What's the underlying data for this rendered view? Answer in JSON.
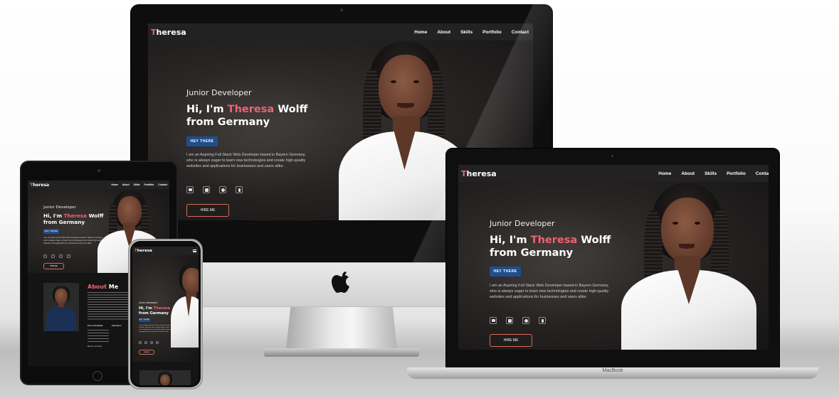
{
  "site": {
    "logo_initial": "T",
    "logo_rest": "heresa",
    "nav": [
      "Home",
      "About",
      "Skills",
      "Portfolio",
      "Contact"
    ],
    "role": "Junior Developer",
    "greeting": "Hi, I'm",
    "name_first": "Theresa",
    "name_last": "Wolff",
    "title_line2": "from Germany",
    "badge": "HEY THERE",
    "description": "I am an Aspiring Full Stack Web Developer based in Bayern Germany, who is always eager to learn new technologies and create high-quality websites and applications for businesses and users alike.",
    "social_icons": [
      "envelope-icon",
      "linkedin-icon",
      "github-icon",
      "facebook-icon"
    ],
    "hire_button": "HIRE ME",
    "about_word1": "About",
    "about_word2": "Me",
    "personal_details": "Personal Details",
    "education": "Education",
    "location": "Bayern, Germany"
  },
  "devices": {
    "laptop_label": "MacBook"
  },
  "colors": {
    "accent": "#f06272",
    "badge_blue": "#1f4e8c",
    "hire_border": "#d66d58",
    "page_bg": "#151515"
  }
}
